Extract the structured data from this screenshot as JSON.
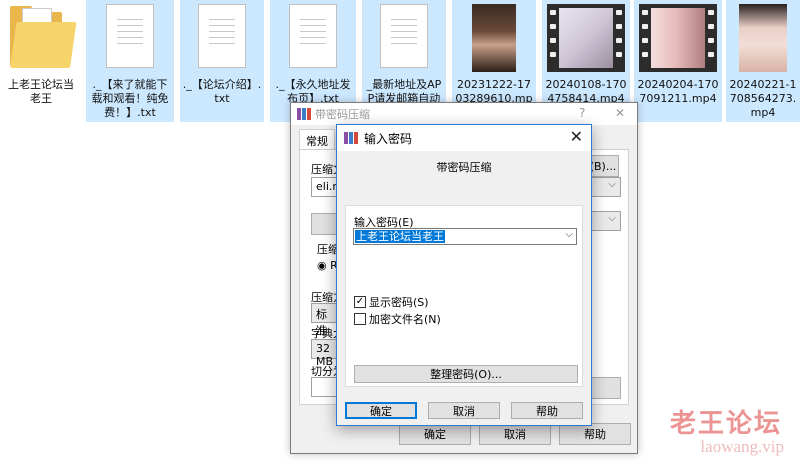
{
  "desktop": {
    "files": [
      {
        "name": "上老王论坛当老王",
        "kind": "folder"
      },
      {
        "name": "._【来了就能下载和观看！纯免费！】.txt",
        "kind": "txt"
      },
      {
        "name": "._【论坛介绍】.txt",
        "kind": "txt"
      },
      {
        "name": "._【永久地址发布页】.txt",
        "kind": "txt"
      },
      {
        "name": "_最新地址及APP请发邮箱自动获",
        "kind": "txt"
      },
      {
        "name": "20231222-1703289610.mp4",
        "kind": "video"
      },
      {
        "name": "20240108-1704758414.mp4",
        "kind": "video"
      },
      {
        "name": "20240204-1707091211.mp4",
        "kind": "video"
      },
      {
        "name": "20240221-1708564273.mp4",
        "kind": "video"
      }
    ]
  },
  "archive_dialog": {
    "title": "带密码压缩",
    "help_glyph": "?",
    "close_glyph": "✕",
    "tab_general": "常规",
    "archive_name_label": "压缩文",
    "archive_name_value": "eli.rar",
    "browse_button": "(B)...",
    "format_label": "压缩",
    "format_radio": "RA",
    "method_label": "压缩方",
    "method_value": "标准",
    "dict_label": "字典大",
    "dict_value": "32 MB",
    "split_label": "切分为",
    "ok_button": "确定",
    "cancel_button": "取消",
    "help_button": "帮助"
  },
  "password_dialog": {
    "title": "输入密码",
    "close_glyph": "✕",
    "heading": "带密码压缩",
    "password_label": "输入密码(E)",
    "password_value": "上老王论坛当老王",
    "show_password_label": "显示密码(S)",
    "show_password_checked": true,
    "encrypt_names_label": "加密文件名(N)",
    "encrypt_names_checked": false,
    "manage_button": "整理密码(O)...",
    "ok_button": "确定",
    "cancel_button": "取消",
    "help_button": "帮助"
  },
  "watermark": {
    "brand": "老王论坛",
    "url": "laowang.vip"
  },
  "colors": {
    "selection_bg": "#cce8ff",
    "accent": "#0078d7",
    "dialog_bg": "#f0f0f0",
    "watermark": "#dc3c3c"
  }
}
